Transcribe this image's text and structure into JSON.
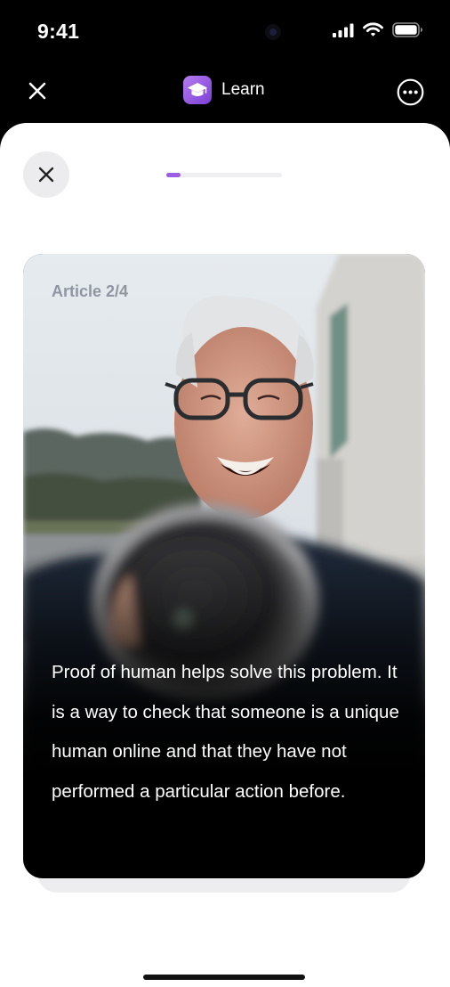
{
  "status_bar": {
    "time": "9:41"
  },
  "header": {
    "title": "Learn"
  },
  "progress": {
    "value": 0.12
  },
  "card": {
    "kicker": "Article 2/4",
    "body": "Proof of human helps solve this problem. It is a way to check that someone is a unique human online and that they have not performed a particular action before."
  },
  "colors": {
    "accent": "#9b5de5",
    "sheet_background": "#ffffff",
    "app_background": "#000000"
  },
  "icons": [
    "close-icon",
    "learn-app-icon",
    "more-options-icon",
    "signal-icon",
    "wifi-icon",
    "battery-icon"
  ]
}
